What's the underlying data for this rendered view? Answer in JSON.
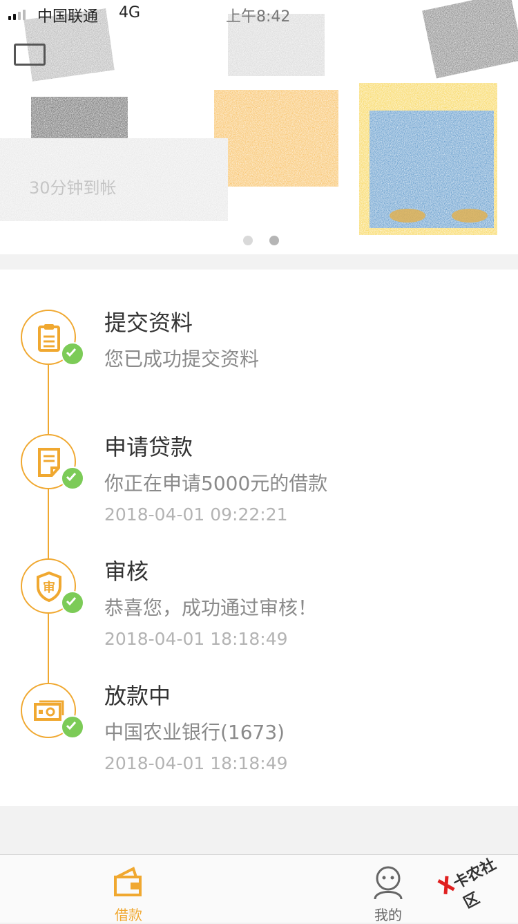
{
  "status_bar": {
    "carrier": "中国联通",
    "network": "4G",
    "time": "上午8:42"
  },
  "banner": {
    "caption": "30分钟到帐",
    "page_count": 2,
    "active_page": 2
  },
  "steps": [
    {
      "title": "提交资料",
      "desc": "您已成功提交资料",
      "time": "",
      "icon": "clipboard-icon",
      "done": true
    },
    {
      "title": "申请贷款",
      "desc": "你正在申请5000元的借款",
      "time": "2018-04-01 09:22:21",
      "icon": "document-icon",
      "done": true
    },
    {
      "title": "审核",
      "desc": "恭喜您，成功通过审核！",
      "time": "2018-04-01 18:18:49",
      "icon": "shield-icon",
      "done": true
    },
    {
      "title": "放款中",
      "desc": "中国农业银行(1673)",
      "time": "2018-04-01 18:18:49",
      "icon": "cash-icon",
      "done": true
    }
  ],
  "tabs": [
    {
      "label": "借款",
      "icon": "wallet-icon",
      "active": true
    },
    {
      "label": "我的",
      "icon": "user-icon",
      "active": false
    }
  ],
  "watermark": {
    "text": "卡农社区"
  },
  "colors": {
    "accent": "#f0a830",
    "check": "#7ccb57",
    "title_text": "#333333",
    "desc_text": "#8a8a8a",
    "time_text": "#b3b3b3"
  }
}
